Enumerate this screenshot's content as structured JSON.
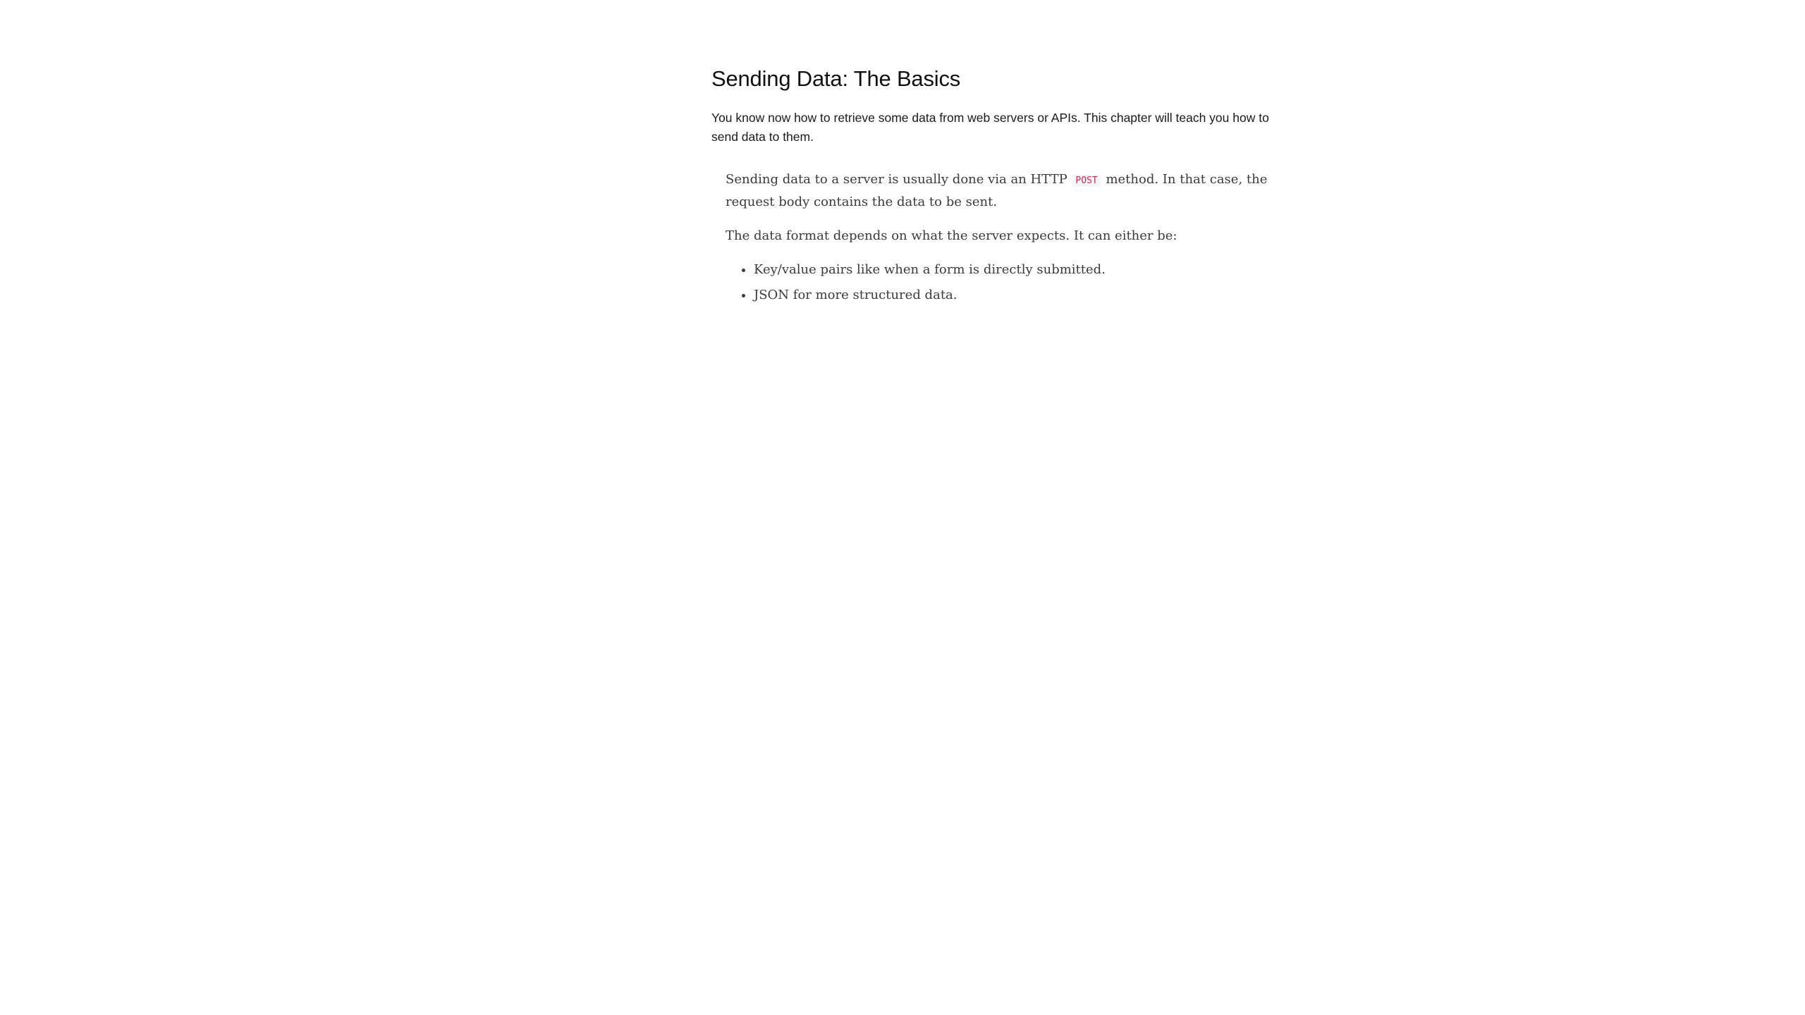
{
  "article": {
    "title": "Sending Data: The Basics",
    "intro": "You know now how to retrieve some data from web servers or APIs. This chapter will teach you how to send data to them.",
    "paragraph1": {
      "before_code": "Sending data to a server is usually done via an HTTP ",
      "code": "POST",
      "after_code": " method. In that case, the request body contains the data to be sent."
    },
    "paragraph2": "The data format depends on what the server expects. It can either be:",
    "list_items": [
      "Key/value pairs like when a form is directly submitted.",
      "JSON for more structured data."
    ]
  },
  "colors": {
    "code_text": "#c7254e",
    "code_background": "#f7f7f9",
    "body_text": "#3a3a3a",
    "heading_text": "#111111"
  }
}
